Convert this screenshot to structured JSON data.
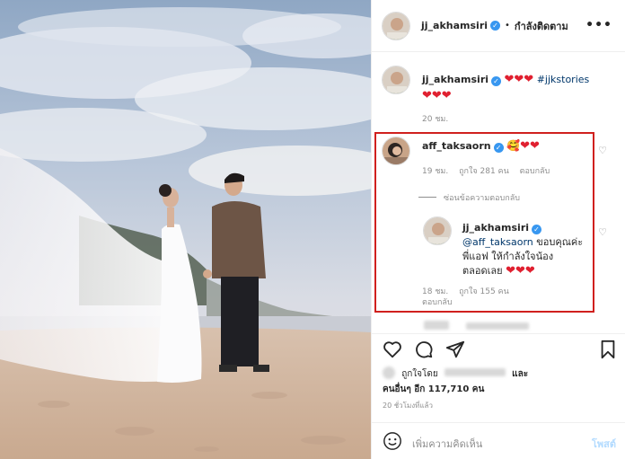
{
  "header": {
    "username": "jj_akhamsiri",
    "separator": "•",
    "follow_status": "กำลังติดตาม",
    "more_label": "•••"
  },
  "caption": {
    "username": "jj_akhamsiri",
    "hearts": "❤❤❤",
    "hashtag": "#jjkstories",
    "hearts2": "❤❤❤",
    "time": "20 ชม."
  },
  "comment": {
    "username": "aff_taksaorn",
    "emoji": "🥰",
    "hearts": "❤❤",
    "time": "19 ชม.",
    "likes": "ถูกใจ 281 คน",
    "reply": "ตอบกลับ",
    "hide_replies": "ซ่อนข้อความตอบกลับ"
  },
  "reply": {
    "username": "jj_akhamsiri",
    "mention": "@aff_taksaorn",
    "text_1": " ขอบคุณค่ะ",
    "text_2": "พี่แอฟ ให้กำลังใจน้อง",
    "text_3": "ตลอดเลย ",
    "hearts": "❤❤❤",
    "time": "18 ชม.",
    "likes": "ถูกใจ 155 คน",
    "reply": "ตอบกลับ"
  },
  "likes": {
    "liked_by": "ถูกใจโดย",
    "and": "และ",
    "others": "คนอื่นๆ อีก 117,710 คน"
  },
  "post_time": "20 ชั่วโมงที่แล้ว",
  "add_comment": {
    "placeholder": "เพิ่มความคิดเห็น",
    "post_button": "โพสต์"
  },
  "colors": {
    "highlight_border": "#d0201e",
    "heart": "#e02030",
    "verified": "#3897f0",
    "link": "#00376b"
  },
  "icons": [
    "heart-icon",
    "comment-icon",
    "share-icon",
    "bookmark-icon",
    "emoji-icon",
    "verified-icon",
    "more-icon"
  ]
}
